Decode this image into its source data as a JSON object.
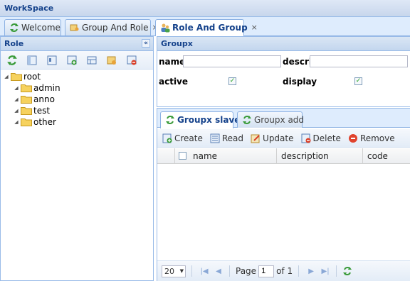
{
  "workspace": {
    "title": "WorkSpace"
  },
  "tabs": [
    {
      "label": "Welcome",
      "closable": false
    },
    {
      "label": "Group And Role",
      "closable": true
    },
    {
      "label": "Role And Group",
      "closable": true,
      "active": true
    }
  ],
  "close_glyph": "×",
  "left": {
    "title": "Role",
    "collapse_glyph": "«",
    "toolbar_icons": [
      "refresh-icon",
      "view-icon",
      "edit-icon",
      "add-icon",
      "grid-icon",
      "key-icon",
      "delete-icon"
    ],
    "tree": {
      "root": "root",
      "children": [
        "admin",
        "anno",
        "test",
        "other"
      ]
    }
  },
  "groupx": {
    "title": "Groupx",
    "name_label": "name",
    "name_value": "",
    "description_label": "descrip",
    "description_value": "",
    "active_label": "active",
    "active_checked": true,
    "display_label": "display",
    "display_checked": true
  },
  "slave": {
    "tabs": [
      {
        "label": "Groupx slave",
        "active": true
      },
      {
        "label": "Groupx add",
        "active": false
      }
    ],
    "toolbar": {
      "create": "Create",
      "read": "Read",
      "update": "Update",
      "delete": "Delete",
      "remove": "Remove"
    },
    "columns": [
      "name",
      "description",
      "code"
    ],
    "rows": []
  },
  "pager": {
    "page_size": "20",
    "page_label": "Page",
    "current_page": "1",
    "of_label": "of 1"
  },
  "colors": {
    "header_text": "#15428b",
    "border": "#99bbe8",
    "tab_bg": "#deecfd"
  }
}
